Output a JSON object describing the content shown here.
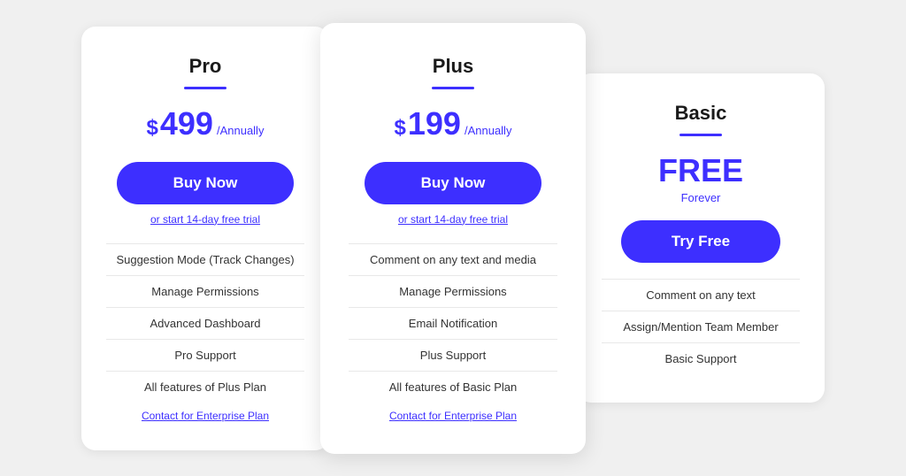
{
  "plans": {
    "pro": {
      "name": "Pro",
      "price_symbol": "$",
      "price_amount": "499",
      "price_period": "/Annually",
      "btn_label": "Buy Now",
      "free_trial_text": "or start 14-day free trial",
      "features": [
        "Suggestion Mode (Track Changes)",
        "Manage Permissions",
        "Advanced Dashboard",
        "Pro Support",
        "All features of Plus Plan"
      ],
      "enterprise_link": "Contact for Enterprise Plan"
    },
    "plus": {
      "name": "Plus",
      "price_symbol": "$",
      "price_amount": "199",
      "price_period": "/Annually",
      "btn_label": "Buy Now",
      "free_trial_text": "or start 14-day free trial",
      "features": [
        "Comment on any text and media",
        "Manage Permissions",
        "Email Notification",
        "Plus Support",
        "All features of Basic Plan"
      ],
      "enterprise_link": "Contact for Enterprise Plan"
    },
    "basic": {
      "name": "Basic",
      "price_label": "FREE",
      "price_sub": "Forever",
      "btn_label": "Try Free",
      "features": [
        "Comment on any text",
        "Assign/Mention Team Member",
        "Basic Support"
      ]
    }
  }
}
